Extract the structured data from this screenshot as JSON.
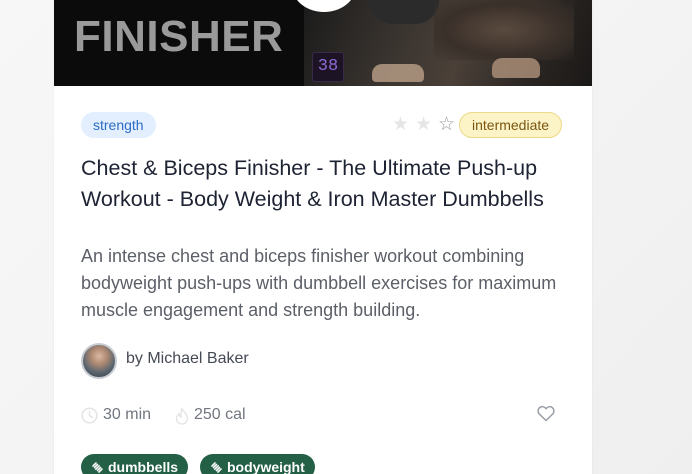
{
  "hero": {
    "title": "FINISHER",
    "badge": "38"
  },
  "card": {
    "category_tag": "strength",
    "rating": {
      "filled": 0,
      "total": 3
    },
    "level": "intermediate",
    "title": "Chest & Biceps Finisher - The Ultimate Push-up Workout - Body Weight & Iron Master Dumbbells",
    "description": "An intense chest and biceps finisher workout combining bodyweight push-ups with dumbbell exercises for maximum muscle engagement and strength building.",
    "author": "by Michael Baker",
    "duration": "30 min",
    "calories": "250 cal",
    "equipment": [
      "dumbbells",
      "bodyweight"
    ]
  },
  "colors": {
    "tag_bg": "#e3efff",
    "tag_text": "#2b6cc4",
    "level_bg": "#fcf3c6",
    "level_text": "#7a5612",
    "chip_bg": "#236046"
  },
  "icons": {
    "duration": "clock-icon",
    "calories": "flame-icon",
    "favorite": "heart-icon",
    "equipment": "dumbbell-icon"
  }
}
